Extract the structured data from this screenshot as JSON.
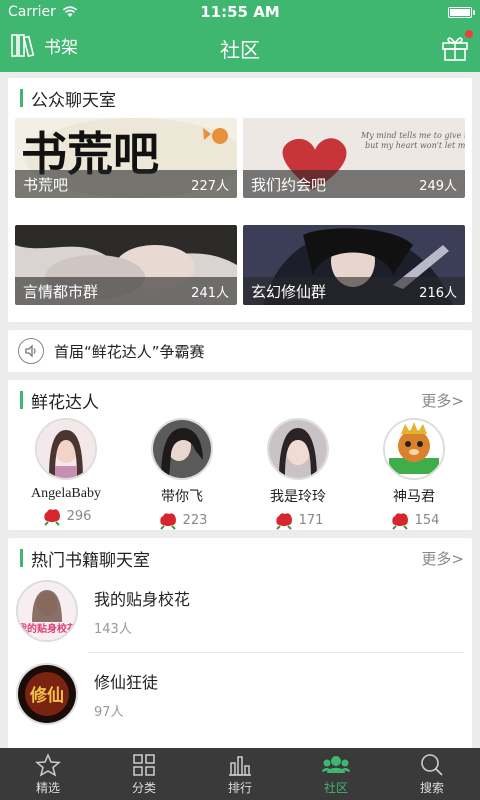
{
  "status": {
    "carrier": "Carrier",
    "time": "11:55 AM"
  },
  "nav": {
    "left_label": "书架",
    "title": "社区"
  },
  "chatrooms": {
    "title": "公众聊天室",
    "rooms": [
      {
        "name": "书荒吧",
        "count": "227人"
      },
      {
        "name": "我们约会吧",
        "count": "249人"
      },
      {
        "name": "言情都市群",
        "count": "241人"
      },
      {
        "name": "玄幻修仙群",
        "count": "216人"
      }
    ],
    "banner_art_text": "书荒吧",
    "heart_note": "My mind tells me to give up but my heart won't let me"
  },
  "notice": {
    "text": "首届“鲜花达人”争霸赛"
  },
  "flower": {
    "title": "鲜花达人",
    "more": "更多>",
    "people": [
      {
        "name": "AngelaBaby",
        "flowers": "296"
      },
      {
        "name": "带你飞",
        "flowers": "223"
      },
      {
        "name": "我是玲玲",
        "flowers": "171"
      },
      {
        "name": "神马君",
        "flowers": "154"
      }
    ]
  },
  "hotbooks": {
    "title": "热门书籍聊天室",
    "more": "更多>",
    "books": [
      {
        "title": "我的贴身校花",
        "count": "143人",
        "cover_text": "我的贴身校花"
      },
      {
        "title": "修仙狂徒",
        "count": "97人",
        "cover_text": "修仙"
      }
    ]
  },
  "tabs": [
    {
      "label": "精选"
    },
    {
      "label": "分类"
    },
    {
      "label": "排行"
    },
    {
      "label": "社区"
    },
    {
      "label": "搜索"
    }
  ],
  "colors": {
    "brand": "#3fb771",
    "tabbar": "#3a3a3a",
    "badge": "#e8423c",
    "flower": "#d8262f"
  }
}
